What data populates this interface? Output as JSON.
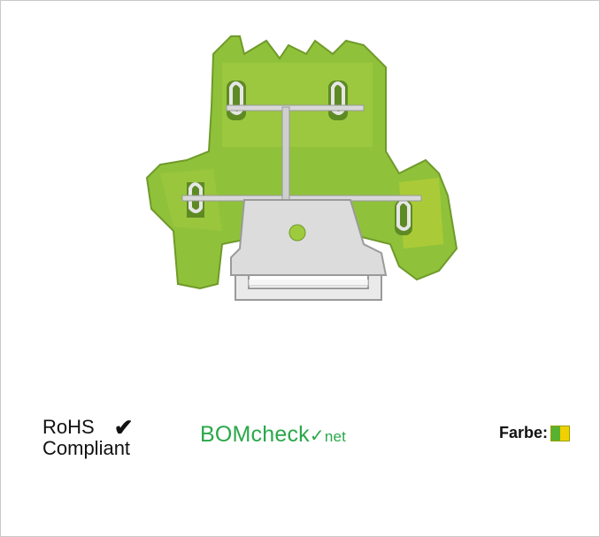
{
  "product": {
    "image_name": "green-yellow-double-deck-terminal-block"
  },
  "rohs": {
    "line1": "RoHS",
    "line2": "Compliant",
    "check": "✔"
  },
  "bomcheck": {
    "part1": "BOMcheck",
    "part2": "net"
  },
  "farbe": {
    "label": "Farbe:",
    "colors": [
      "#58b130",
      "#f0d000"
    ]
  }
}
